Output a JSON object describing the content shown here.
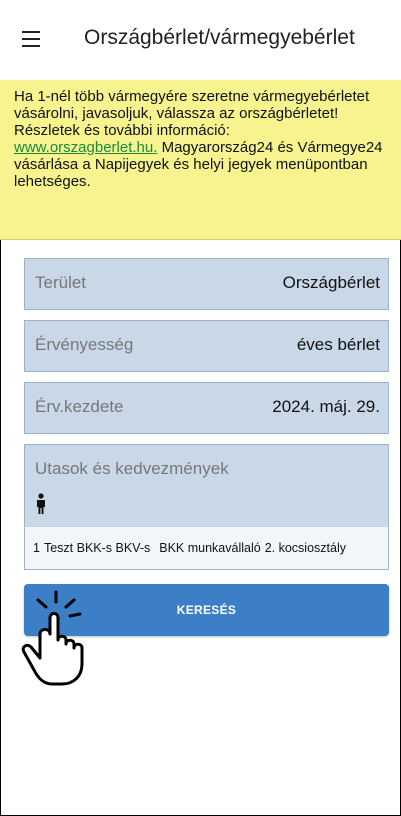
{
  "header": {
    "title": "Országbérlet/vármegyebérlet",
    "menu_icon": "hamburger-menu-icon"
  },
  "notice": {
    "text_before_link": "Ha 1-nél több vármegyére szeretne vármegyebérletet vásárolni, javasoljuk, válassza az országbérletet! Részletek és további információ:",
    "link": "www.orszagberlet.hu.",
    "text_after_link": "Magyarország24 és Vármegye24 vásárlása a Napijegyek és helyi jegyek menüpontban lehetséges.",
    "background_color": "#f7f48f",
    "link_color": "#1a8a3c"
  },
  "form": {
    "terulet": {
      "label": "Terület",
      "value": "Országbérlet"
    },
    "ervenyesseg": {
      "label": "Érvényesség",
      "value": "éves bérlet"
    },
    "kezdete": {
      "label": "Érv.kezdete",
      "value": "2024. máj. 29."
    },
    "passengers": {
      "label": "Utasok és kedvezmények",
      "icon": "person-icon",
      "row": {
        "count": "1",
        "name": "Teszt BKK-s BKV-s",
        "discount": "BKK munkavállaló",
        "class": "2. kocsiosztály"
      }
    },
    "field_color": "#c9d8e6"
  },
  "search_button": {
    "label": "KERESÉS",
    "color": "#3d7fc6",
    "overlay_icon": "tap-hand-icon"
  }
}
